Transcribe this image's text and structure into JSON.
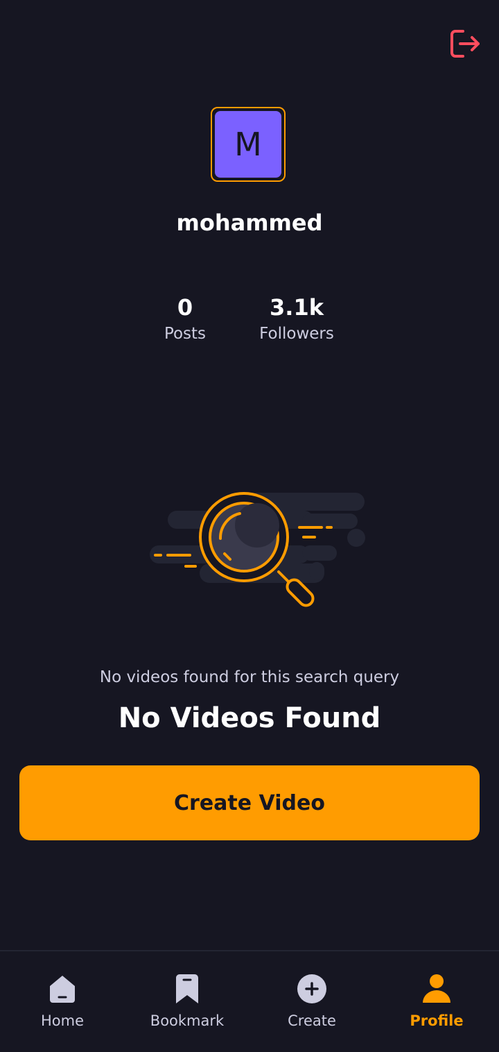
{
  "header": {
    "logout_icon": "logout-icon"
  },
  "profile": {
    "avatar_initial": "M",
    "username": "mohammed",
    "stats": [
      {
        "value": "0",
        "label": "Posts"
      },
      {
        "value": "3.1k",
        "label": "Followers"
      }
    ]
  },
  "empty_state": {
    "illustration": "magnifying-glass-icon",
    "subtitle": "No videos found for this search query",
    "title": "No Videos Found",
    "button_label": "Create Video"
  },
  "tabs": [
    {
      "label": "Home",
      "icon": "home-icon",
      "active": false
    },
    {
      "label": "Bookmark",
      "icon": "bookmark-icon",
      "active": false
    },
    {
      "label": "Create",
      "icon": "plus-icon",
      "active": false
    },
    {
      "label": "Profile",
      "icon": "profile-icon",
      "active": true
    }
  ],
  "colors": {
    "background": "#161622",
    "accent": "#FF9C01",
    "avatar": "#7B61FF",
    "logout": "#FF4D5E",
    "muted_text": "#CDCDE0"
  }
}
